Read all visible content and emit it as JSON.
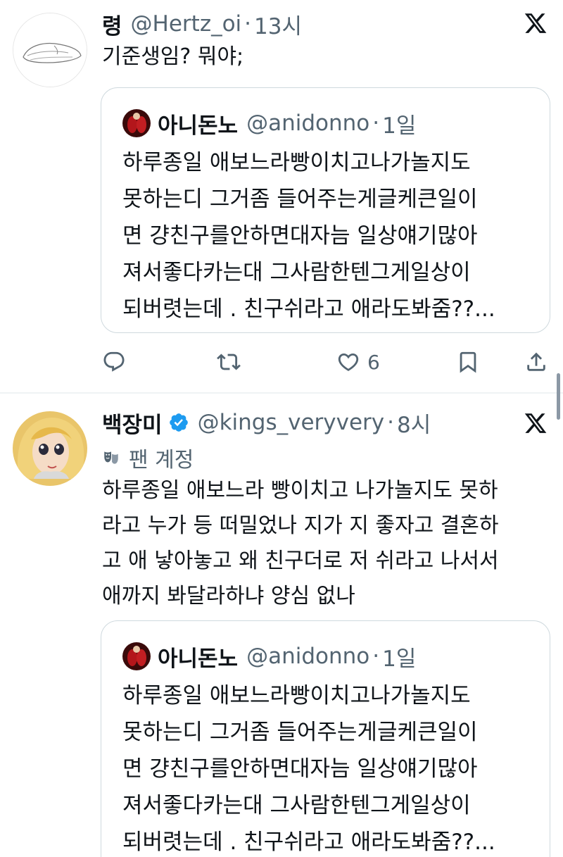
{
  "tweets": [
    {
      "name": "령",
      "handle": "@Hertz_oi",
      "separator": "·",
      "time": "13시",
      "text": "기준생임? 뭐야;",
      "quote": {
        "name": "아니돈노",
        "handle": "@anidonno",
        "separator": "·",
        "time": "1일",
        "lines": [
          "하루종일 애보느라빵이치고나가놀지도",
          "못하는디 그거좀 들어주는게글케큰일이",
          "면 걍친구를안하면대자늠 일상얘기많아",
          "져서좋다카는대 그사람한텐그게일상이",
          "되버렷는데 . 친구쉬라고 애라도봐줌??..."
        ]
      },
      "actions": {
        "reply_icon": "reply-icon",
        "retweet_icon": "retweet-icon",
        "like_icon": "heart-icon",
        "like_count": "6",
        "bookmark_icon": "bookmark-icon",
        "share_icon": "share-icon"
      }
    },
    {
      "name": "백장미",
      "handle": "@kings_veryvery",
      "separator": "·",
      "time": "8시",
      "badge": "팬 계정",
      "text_lines": [
        "하루종일 애보느라 빵이치고 나가놀지도 못하",
        "라고 누가 등 떠밀었나 지가 지 좋자고 결혼하",
        "고 애 낳아놓고 왜 친구더로 저 쉬라고 나서서",
        "애까지 봐달라하냐 양심 없나"
      ],
      "quote": {
        "name": "아니돈노",
        "handle": "@anidonno",
        "separator": "·",
        "time": "1일",
        "lines": [
          "하루종일 애보느라빵이치고나가놀지도",
          "못하는디 그거좀 들어주는게글케큰일이",
          "면 걍친구를안하면대자늠 일상얘기많아",
          "져서좋다카는대 그사람한텐그게일상이",
          "되버렷는데 . 친구쉬라고 애라도봐줌??..."
        ]
      }
    }
  ],
  "colors": {
    "text": "#0f1419",
    "secondary": "#536471",
    "border": "#cfd9de",
    "verified": "#1d9bf0"
  }
}
